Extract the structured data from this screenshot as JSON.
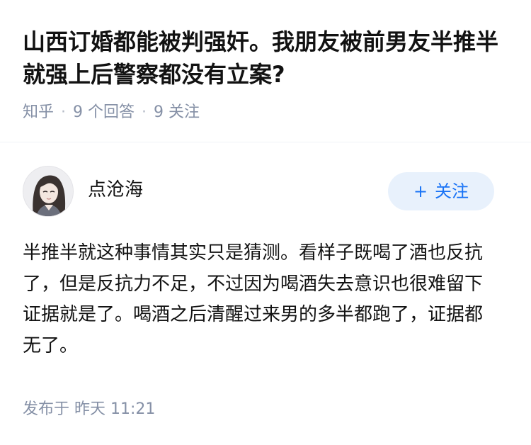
{
  "question": {
    "title": "山西订婚都能被判强奸。我朋友被前男友半推半就强上后警察都没有立案?",
    "source": "知乎",
    "answer_count": "9 个回答",
    "follower_count": "9 关注"
  },
  "answer": {
    "author": {
      "name": "点沧海",
      "avatar_icon": "avatar-illustration"
    },
    "follow_button": {
      "plus": "+",
      "label": "关注"
    },
    "content": "半推半就这种事情其实只是猜测。看样子既喝了酒也反抗了，但是反抗力不足，不过因为喝酒失去意识也很难留下证据就是了。喝酒之后清醒过来男的多半都跑了，证据都无了。",
    "published": "发布于  昨天 11:21"
  },
  "colors": {
    "text_primary": "#121212",
    "text_meta": "#8590a6",
    "follow_text": "#1772f6",
    "follow_bg": "#e8f1fc"
  }
}
